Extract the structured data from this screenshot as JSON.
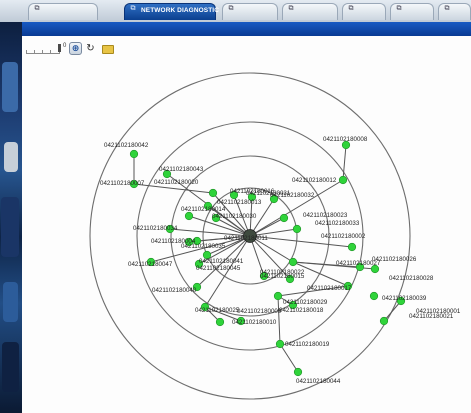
{
  "tabs": [
    {
      "label": "",
      "active": false
    },
    {
      "label": "NETWORK DIAGNOSTIC",
      "active": true
    },
    {
      "label": "",
      "active": false
    },
    {
      "label": "",
      "active": false
    },
    {
      "label": "",
      "active": false
    },
    {
      "label": "",
      "active": false
    },
    {
      "label": "",
      "active": false
    }
  ],
  "toolbar": {
    "zoom_value": "0",
    "icons": {
      "zoom_in": "zoom-in-icon",
      "refresh": "refresh-icon",
      "folder": "folder-icon"
    }
  },
  "colors": {
    "accent": "#0b3f8f",
    "node": "#2fd33a",
    "root_node": "#3e4a3e",
    "edge": "#555555",
    "ring": "#6e6e6e"
  },
  "graph": {
    "root": "0421102180011",
    "nodes": [
      {
        "label": "0421102180008"
      },
      {
        "label": "0421102180042"
      },
      {
        "label": "0421102180043"
      },
      {
        "label": "0421102180007"
      },
      {
        "label": "0421102180012"
      },
      {
        "label": "0421102180020"
      },
      {
        "label": "0421102180016"
      },
      {
        "label": "0421102180031"
      },
      {
        "label": "0421102180032"
      },
      {
        "label": "0421102180013"
      },
      {
        "label": "0421102180014"
      },
      {
        "label": "0421102180030"
      },
      {
        "label": "0421102180023"
      },
      {
        "label": "0421102180034"
      },
      {
        "label": "0421102180033"
      },
      {
        "label": "0421102180004"
      },
      {
        "label": "0421102180035"
      },
      {
        "label": "0421102180002"
      },
      {
        "label": "0421102180041"
      },
      {
        "label": "0421102180047"
      },
      {
        "label": "0421102180045"
      },
      {
        "label": "0421102180027"
      },
      {
        "label": "0421102180022"
      },
      {
        "label": "0421102180015"
      },
      {
        "label": "0421102180026"
      },
      {
        "label": "0421102180028"
      },
      {
        "label": "0421102180040"
      },
      {
        "label": "0421102180017"
      },
      {
        "label": "0421102180039"
      },
      {
        "label": "0421102180001"
      },
      {
        "label": "0421102180029"
      },
      {
        "label": "0421102180018"
      },
      {
        "label": "0421102180009"
      },
      {
        "label": "0421102180021"
      },
      {
        "label": "0421102180025"
      },
      {
        "label": "0421102180010"
      },
      {
        "label": "0421102180019"
      },
      {
        "label": "0421102180044"
      }
    ]
  }
}
